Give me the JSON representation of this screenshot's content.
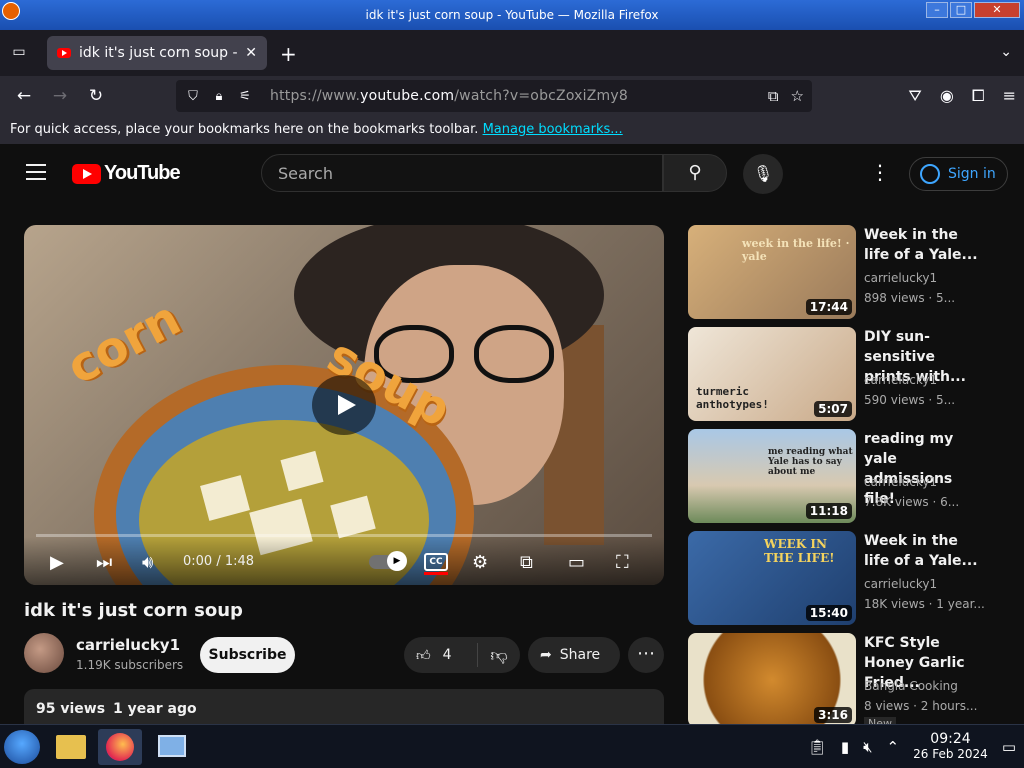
{
  "window": {
    "title": "idk it's just corn soup - YouTube — Mozilla Firefox"
  },
  "browser": {
    "tab_title": "idk it's just corn soup - Y",
    "url_prefix": "https://www.",
    "url_domain": "youtube.com",
    "url_path": "/watch?v=obcZoxiZmy8",
    "bookmarks_text": "For quick access, place your bookmarks here on the bookmarks toolbar. ",
    "bookmarks_link": "Manage bookmarks..."
  },
  "yt": {
    "logo_text": "YouTube",
    "search_placeholder": "Search",
    "signin_label": "Sign in"
  },
  "player": {
    "overlay_words": [
      "corn",
      "soup"
    ],
    "time": "0:00 / 1:48",
    "cc_label": "CC"
  },
  "video": {
    "title": "idk it's just corn soup",
    "channel": "carrielucky1",
    "subscribers": "1.19K subscribers",
    "subscribe_label": "Subscribe",
    "likes": "4",
    "share_label": "Share",
    "views": "95 views",
    "age": "1 year ago"
  },
  "recommendations": [
    {
      "title": "Week in the life of a Yale...",
      "channel": "carrielucky1",
      "meta": "898 views · 5...",
      "duration": "17:44",
      "thumb_text": "week in the life! · yale",
      "color": "#c9a36a"
    },
    {
      "title": "DIY sun-sensitive prints with...",
      "channel": "carrielucky1",
      "meta": "590 views · 5...",
      "duration": "5:07",
      "thumb_text": "turmeric anthotypes!",
      "color": "#e8dccb"
    },
    {
      "title": "reading my yale admissions file!",
      "channel": "carrielucky1",
      "meta": "7.8K views · 6...",
      "duration": "11:18",
      "thumb_text": "me reading what Yale has to say about me",
      "color": "#8fb6d8"
    },
    {
      "title": "Week in the life of a Yale...",
      "channel": "carrielucky1",
      "meta": "18K views · 1 year...",
      "duration": "15:40",
      "thumb_text": "WEEK IN THE LIFE!",
      "color": "#2f5f9c"
    },
    {
      "title": "KFC Style Honey Garlic Fried...",
      "channel": "Bangla Cooking",
      "meta": "8 views · 2 hours...",
      "duration": "3:16",
      "badge": "New",
      "thumb_text": "",
      "color": "#b7731e"
    }
  ],
  "taskbar": {
    "time": "09:24",
    "date": "26 Feb 2024"
  }
}
